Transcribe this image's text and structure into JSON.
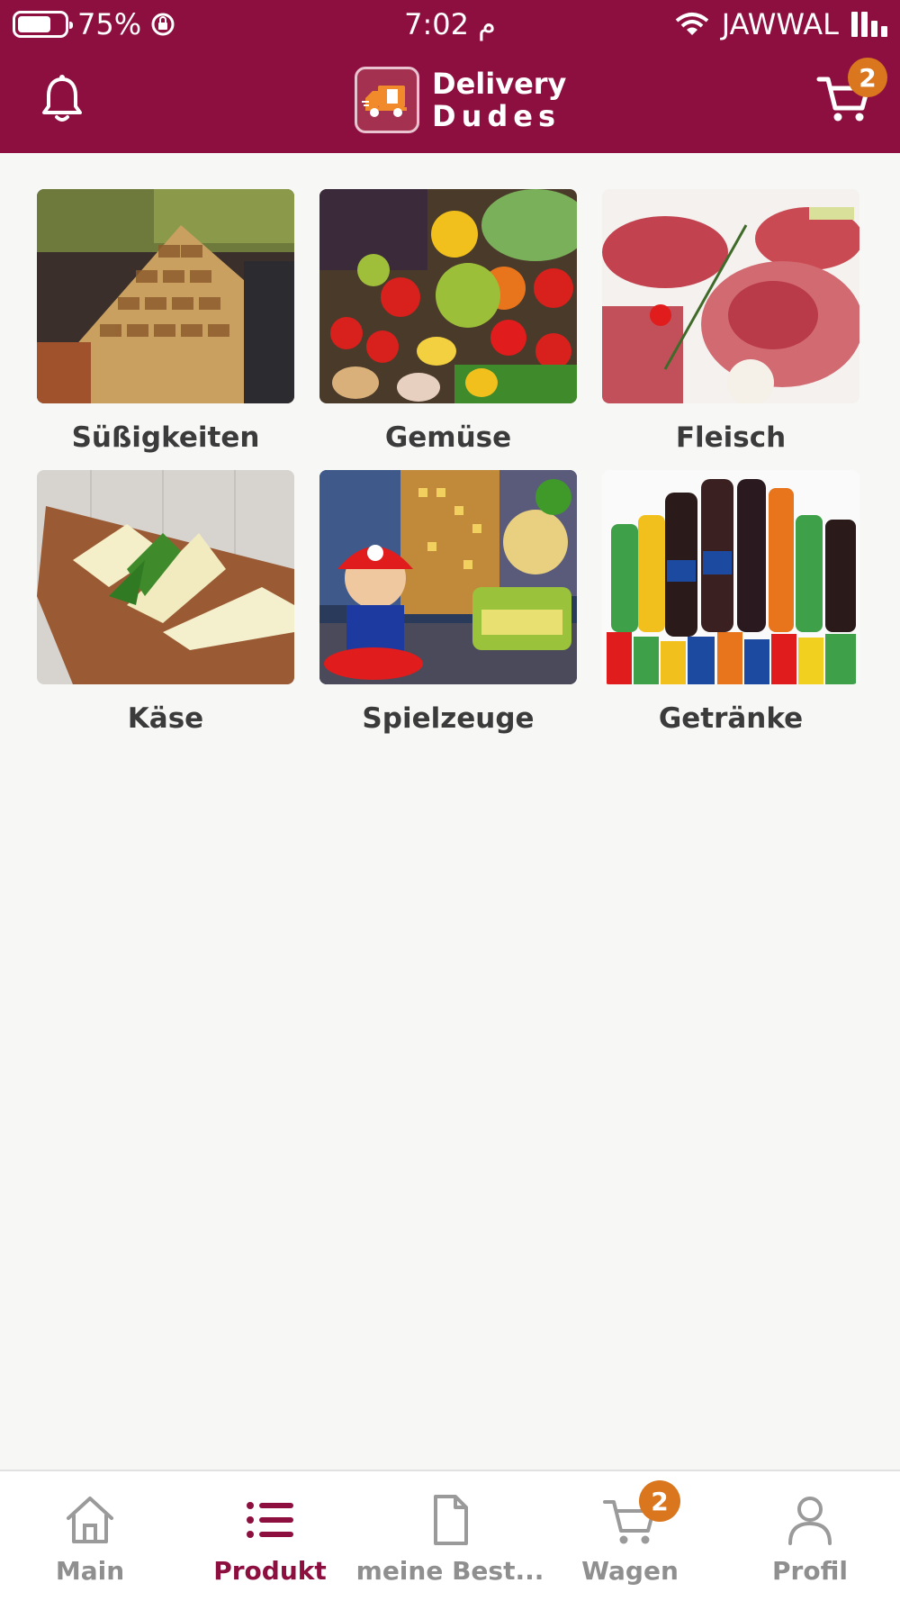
{
  "status_bar": {
    "battery": "75%",
    "time": "7:02 م",
    "carrier": "JAWWAL"
  },
  "header": {
    "logo_line1": "Delivery",
    "logo_line2": "Dudes",
    "cart_count": "2",
    "colors": {
      "brand": "#8c0f3f",
      "badge": "#d9761e"
    }
  },
  "categories": [
    {
      "label": "Süßigkeiten",
      "icon": "baklava-photo"
    },
    {
      "label": "Gemüse",
      "icon": "vegetables-photo"
    },
    {
      "label": "Fleisch",
      "icon": "meat-photo"
    },
    {
      "label": "Käse",
      "icon": "cheese-photo"
    },
    {
      "label": "Spielzeuge",
      "icon": "toy-kart-photo"
    },
    {
      "label": "Getränke",
      "icon": "drinks-photo"
    }
  ],
  "nav": {
    "items": [
      {
        "label": "Main",
        "icon": "home-icon"
      },
      {
        "label": "Produkt",
        "icon": "list-icon"
      },
      {
        "label": "meine Best...",
        "icon": "document-icon"
      },
      {
        "label": "Wagen",
        "icon": "cart-icon"
      },
      {
        "label": "Profil",
        "icon": "person-icon"
      }
    ],
    "active": "Produkt",
    "cart_count": "2"
  }
}
